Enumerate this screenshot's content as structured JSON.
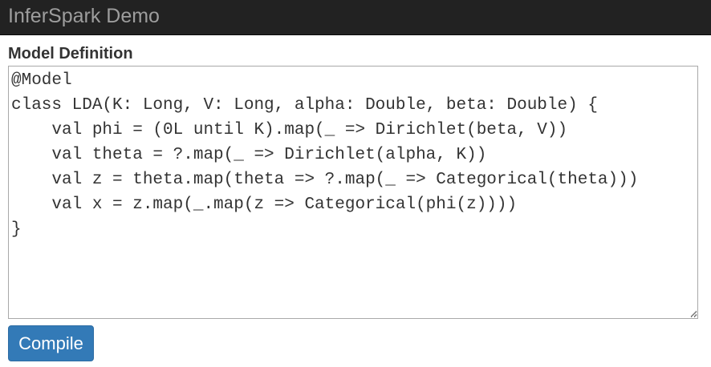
{
  "navbar": {
    "brand": "InferSpark Demo"
  },
  "model_section": {
    "label": "Model Definition",
    "code": "@Model\nclass LDA(K: Long, V: Long, alpha: Double, beta: Double) {\n    val phi = (0L until K).map(_ => Dirichlet(beta, V))\n    val theta = ?.map(_ => Dirichlet(alpha, K))\n    val z = theta.map(theta => ?.map(_ => Categorical(theta)))\n    val x = z.map(_.map(z => Categorical(phi(z))))\n}"
  },
  "actions": {
    "compile_label": "Compile"
  },
  "colors": {
    "navbar_bg": "#222222",
    "brand_text": "#9d9d9d",
    "primary_button": "#337ab7"
  }
}
